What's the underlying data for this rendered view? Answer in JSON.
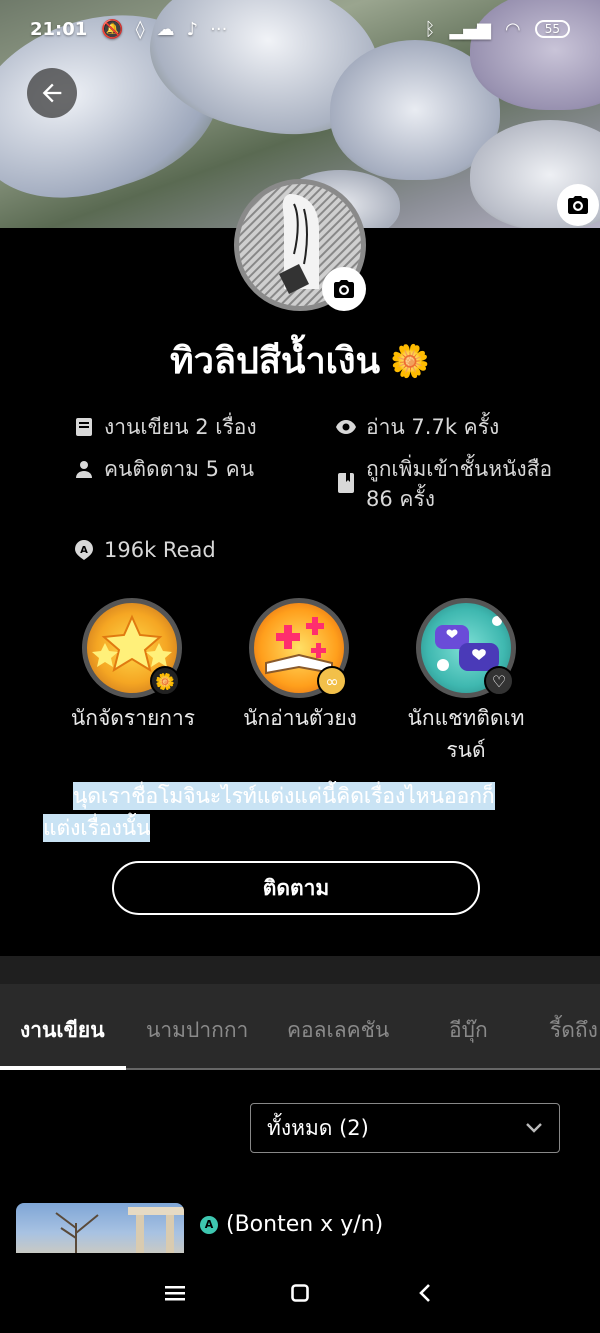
{
  "status_bar": {
    "time": "21:01",
    "battery": "55"
  },
  "profile": {
    "name": "ทิวลิปสีน้ำเงิน",
    "name_emoji": "🌼"
  },
  "stats": {
    "works": "งานเขียน 2 เรื่อง",
    "reads": "อ่าน 7.7k ครั้ง",
    "followers": "คนติดตาม 5 คน",
    "shelf_line1": "ถูกเพิ่มเข้าชั้นหนังสือ",
    "shelf_line2": "86 ครั้ง",
    "read_count": "196k Read"
  },
  "badges": [
    {
      "label": "นักจัดรายการ",
      "icon": "stars-icon"
    },
    {
      "label": "นักอ่านตัวยง",
      "icon": "open-book-icon"
    },
    {
      "label_line1": "นักแชทติดเท",
      "label_line2": "รนด์",
      "icon": "chat-hearts-icon"
    }
  ],
  "bio": {
    "line1": "นุดเราชื่อโมจินะไรท์แต่งแค่นี้คิดเรื่องไหนออกก็",
    "line2": "แต่งเรื่องนั้น"
  },
  "follow_button": "ติดตาม",
  "tabs": [
    "งานเขียน",
    "นามปากกา",
    "คอลเลคชัน",
    "อีบุ๊ก",
    "รี้ดถึง"
  ],
  "filter": {
    "selected": "ทั้งหมด (2)"
  },
  "story": {
    "title": "(Bonten x y/n)",
    "badge_letter": "A"
  },
  "colors": {
    "background": "#000000",
    "tab_bar": "#2a2a2a",
    "bio_highlight": "#c9e3f4",
    "read_badge": "#3ec7b0"
  }
}
